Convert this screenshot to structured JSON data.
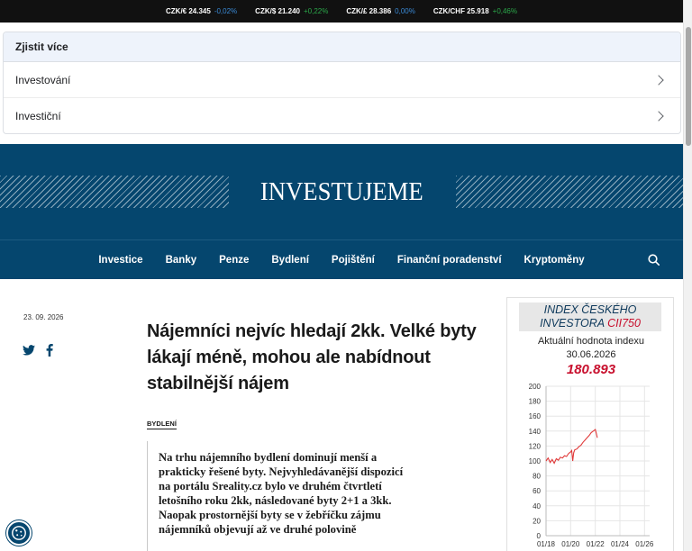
{
  "ticker": [
    {
      "pair": "CZK/€ 24.345",
      "change": "-0,02%",
      "tone": "neg"
    },
    {
      "pair": "CZK/$ 21.240",
      "change": "+0,22%",
      "tone": "pos"
    },
    {
      "pair": "CZK/£ 28.386",
      "change": "0,00%",
      "tone": "zero"
    },
    {
      "pair": "CZK/CHF 25.918",
      "change": "+0,46%",
      "tone": "pos"
    }
  ],
  "explore": {
    "title": "Zjistit více",
    "items": [
      "Investování",
      "Investiční"
    ]
  },
  "brand": {
    "logo": "INVESTUJEME"
  },
  "nav": {
    "items": [
      "Investice",
      "Banky",
      "Penze",
      "Bydlení",
      "Pojištění",
      "Finanční poradenství",
      "Kryptoměny"
    ]
  },
  "article": {
    "date": "23. 09. 2026",
    "headline": "Nájemníci nejvíc hledají 2kk. Velké byty lákají méně, mohou ale nabídnout stabilnější nájem",
    "category": "BYDLENÍ",
    "lead": "Na trhu nájemního bydlení dominují menší a prakticky řešené byty. Nejvyhledávanější dispozicí na portálu Sreality.cz bylo ve druhém čtvrtletí letošního roku 2kk, následované byty 2+1 a 3kk. Naopak prostornější byty se v žebříčku zájmu nájemníků objevují až ve druhé polovině"
  },
  "index_widget": {
    "title_line1": "INDEX ČESKÉHO",
    "title_line2_prefix": "INVESTORA ",
    "title_line2_code": "CII750",
    "subtitle": "Aktuální hodnota indexu",
    "date": "30.06.2026",
    "value": "180.893"
  },
  "chart_data": {
    "type": "line",
    "series": [
      {
        "x": [
          "2018-01",
          "2018-03",
          "2018-05",
          "2018-07",
          "2018-09",
          "2018-11",
          "2019-01",
          "2019-03",
          "2019-05",
          "2019-07",
          "2019-09",
          "2019-11",
          "2020-01",
          "2020-02",
          "2020-03",
          "2020-04",
          "2020-05",
          "2020-07",
          "2020-09",
          "2020-11",
          "2021-01",
          "2021-03",
          "2021-05",
          "2021-07",
          "2021-09",
          "2021-11",
          "2022-01",
          "2022-02",
          "2022-03"
        ],
        "values": [
          100,
          104,
          98,
          102,
          97,
          103,
          101,
          105,
          104,
          107,
          106,
          110,
          112,
          114,
          100,
          111,
          115,
          116,
          119,
          121,
          125,
          128,
          131,
          134,
          138,
          140,
          142,
          137,
          131
        ]
      }
    ],
    "x_tick_labels": [
      "01/18",
      "01/20",
      "01/22",
      "01/24",
      "01/26"
    ],
    "y_ticks": [
      0,
      20,
      40,
      60,
      80,
      100,
      120,
      140,
      160,
      180,
      200
    ],
    "ylim": [
      0,
      200
    ],
    "xlim": [
      "2018-01",
      "2026-06"
    ],
    "grid": true,
    "line_color": "#e03a3a"
  },
  "colors": {
    "brand": "#05466e",
    "accent_red": "#c8102e",
    "ticker_bg": "#111111"
  }
}
